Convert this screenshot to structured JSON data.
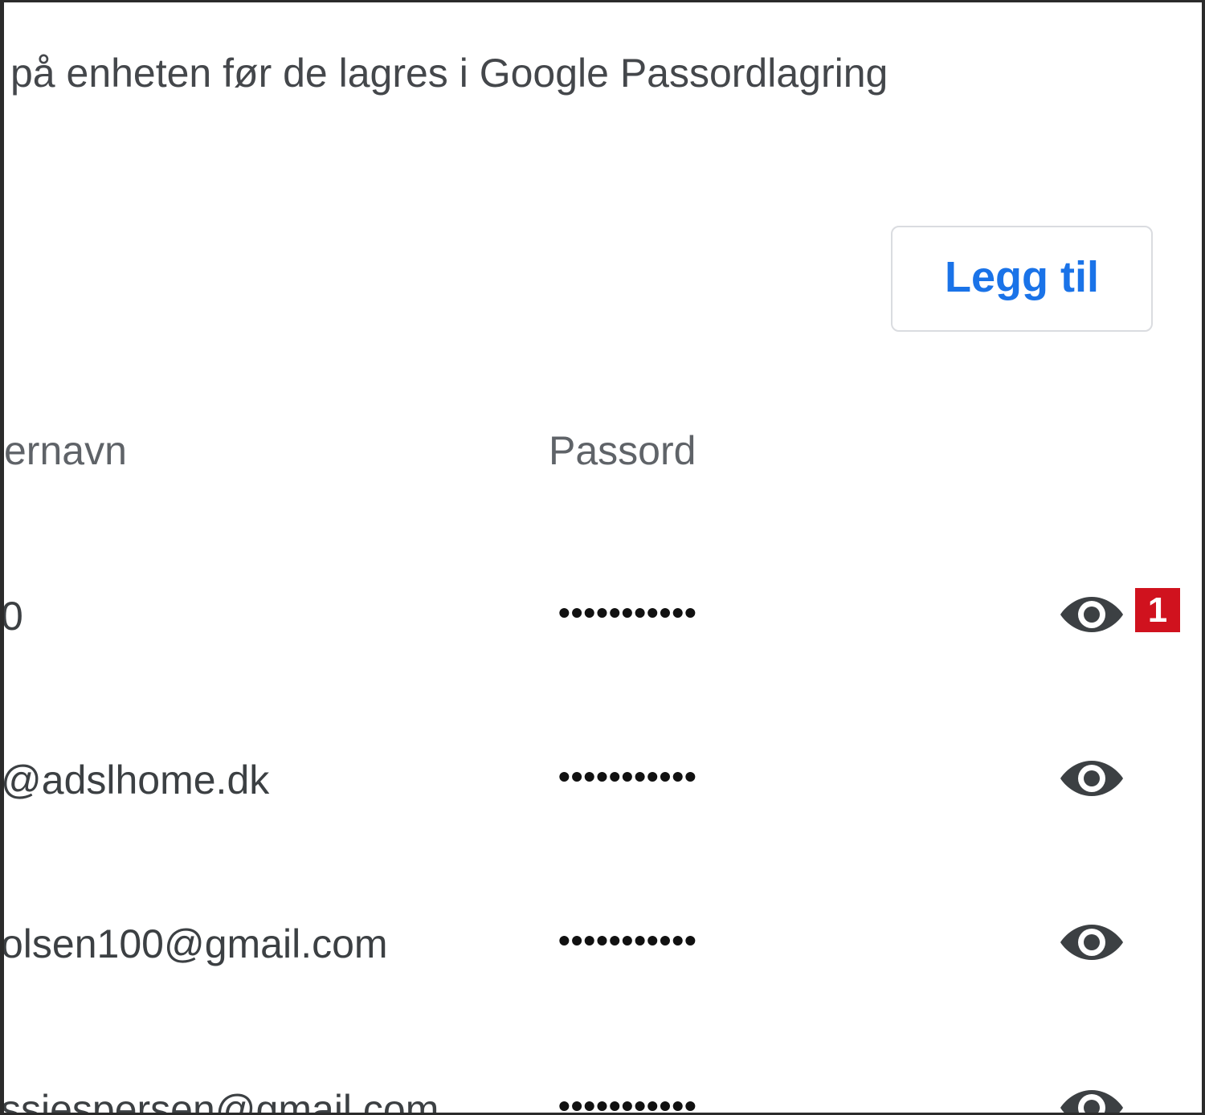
{
  "description": "på enheten før de lagres i Google Passordlagring",
  "add_button": {
    "label": "Legg til"
  },
  "columns": {
    "username": "ernavn",
    "password": "Passord"
  },
  "rows": [
    {
      "username": "0",
      "password": "•••••••••••",
      "icon": "eye-icon"
    },
    {
      "username": "@adslhome.dk",
      "password": "•••••••••••",
      "icon": "eye-icon"
    },
    {
      "username": "olsen100@gmail.com",
      "password": "•••••••••••",
      "icon": "eye-icon"
    },
    {
      "username": "ssiespersen@gmail.com",
      "password": "•••••••••••",
      "icon": "eye-icon"
    }
  ],
  "annotation_badge": {
    "label": "1",
    "color": "#d0121e"
  },
  "colors": {
    "accent": "#1a73e8",
    "text": "#3c4043",
    "icon": "#3c4043"
  }
}
